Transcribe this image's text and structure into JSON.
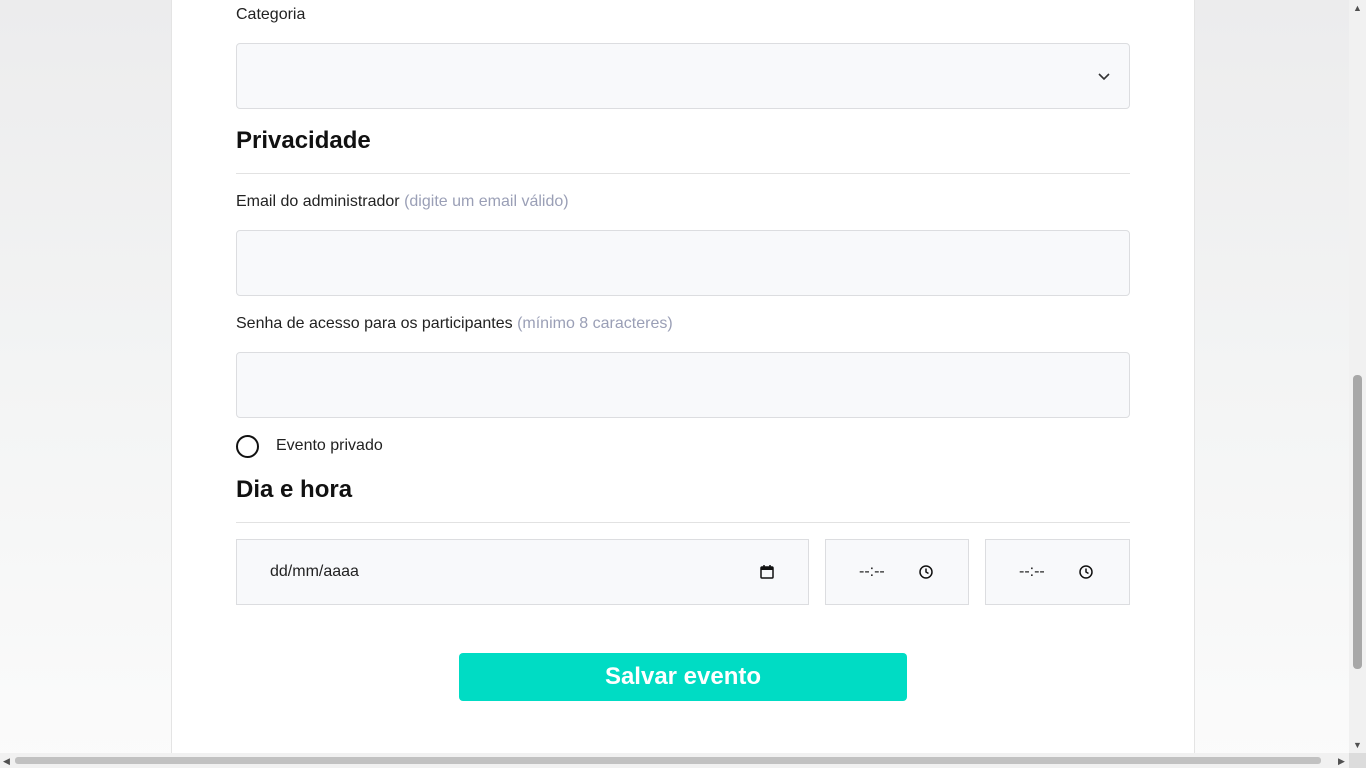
{
  "form": {
    "category": {
      "label": "Categoria",
      "value": ""
    },
    "privacy": {
      "title": "Privacidade",
      "admin_email": {
        "label": "Email do administrador",
        "hint": "(digite um email válido)",
        "value": ""
      },
      "password": {
        "label": "Senha de acesso para os participantes",
        "hint": "(mínimo 8 caracteres)",
        "value": ""
      },
      "private_event": {
        "label": "Evento privado",
        "checked": false
      }
    },
    "datetime": {
      "title": "Dia e hora",
      "date_placeholder": "dd/mm/aaaa",
      "start_time_placeholder": "--:--",
      "end_time_placeholder": "--:--"
    },
    "save_label": "Salvar evento"
  },
  "icons": {
    "select": "chevron-down-icon",
    "date": "calendar-icon",
    "time": "clock-icon"
  },
  "colors": {
    "accent": "#00dcc4",
    "hint": "#9a9fb6",
    "field_bg": "#f8f9fb"
  }
}
